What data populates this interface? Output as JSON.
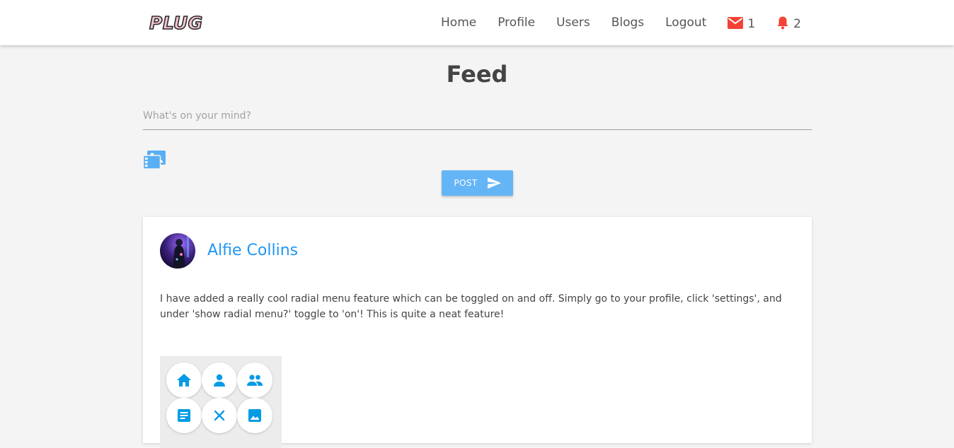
{
  "app": {
    "logo": "PLUG"
  },
  "nav": {
    "links": [
      "Home",
      "Profile",
      "Users",
      "Blogs",
      "Logout"
    ],
    "messages_count": "1",
    "notifications_count": "2",
    "icons": {
      "messages": "mail-icon",
      "notifications": "bell-icon"
    },
    "colors": {
      "alert": "#f44336"
    }
  },
  "page": {
    "title": "Feed"
  },
  "composer": {
    "placeholder": "What's on your mind?",
    "image_icon": "image-upload-icon",
    "post_label": "POST",
    "post_icon": "send-icon",
    "colors": {
      "button": "#64b5f6"
    }
  },
  "post": {
    "author": "Alfie Collins",
    "text": "I have added a really cool radial menu feature which can be toggled on and off. Simply go to your profile, click 'settings', and under 'show radial menu?' toggle to 'on'! This is quite a neat feature!",
    "image_icons": [
      "home-icon",
      "person-icon",
      "people-icon",
      "article-icon",
      "close-icon",
      "image-icon"
    ],
    "colors": {
      "author": "#2196f3",
      "menu_icons": "#039be5"
    }
  }
}
